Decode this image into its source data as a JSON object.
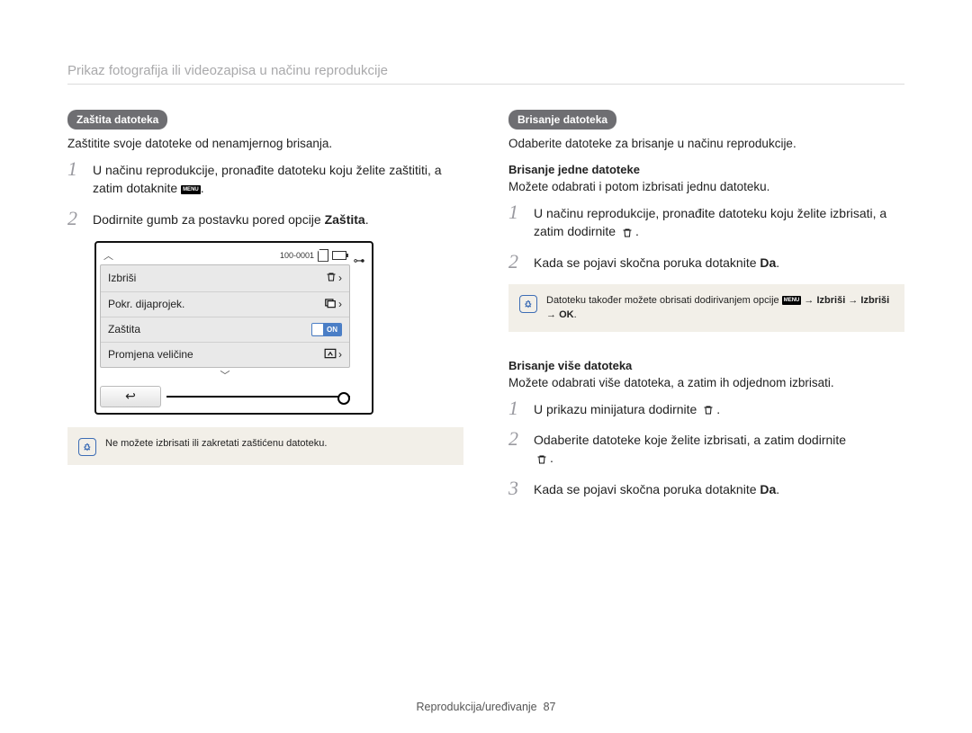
{
  "header": "Prikaz fotografija ili videozapisa u načinu reprodukcije",
  "left": {
    "pill": "Zaštita datoteka",
    "lead": "Zaštitite svoje datoteke od nenamjernog brisanja.",
    "step1_a": "U načinu reprodukcije, pronađite datoteku koju želite zaštititi, a zatim dotaknite ",
    "step1_b": ".",
    "step2_a": "Dodirnite gumb za postavku pored opcije ",
    "step2_bold": "Zaštita",
    "step2_c": ".",
    "camera": {
      "counter": "100-0001",
      "items": {
        "delete": "Izbriši",
        "slideshow": "Pokr. dijaprojek.",
        "protect": "Zaštita",
        "resize": "Promjena veličine"
      },
      "on": "ON",
      "back": "↩"
    },
    "note": "Ne možete izbrisati ili zakretati zaštićenu datoteku."
  },
  "right": {
    "pill": "Brisanje datoteka",
    "lead": "Odaberite datoteke za brisanje u načinu reprodukcije.",
    "sec1": {
      "title": "Brisanje jedne datoteke",
      "lead": "Možete odabrati i potom izbrisati jednu datoteku.",
      "step1_a": "U načinu reprodukcije, pronađite datoteku koju želite izbrisati, a zatim dodirnite ",
      "step1_b": ".",
      "step2_a": "Kada se pojavi skočna poruka dotaknite ",
      "step2_bold": "Da",
      "step2_c": ".",
      "note_a": "Datoteku također možete obrisati dodirivanjem opcije ",
      "note_arrow": " → ",
      "note_b1": "Izbriši",
      "note_b2": "Izbriši",
      "note_ok": "OK",
      "note_c": "."
    },
    "sec2": {
      "title": "Brisanje više datoteka",
      "lead": "Možete odabrati više datoteka, a zatim ih odjednom izbrisati.",
      "step1_a": "U prikazu minijatura dodirnite ",
      "step1_b": ".",
      "step2_a": "Odaberite datoteke koje želite izbrisati, a zatim dodirnite ",
      "step2_b": ".",
      "step3_a": "Kada se pojavi skočna poruka dotaknite ",
      "step3_bold": "Da",
      "step3_c": "."
    }
  },
  "footer_label": "Reprodukcija/uređivanje",
  "page_num": "87",
  "menu_label": "MENU"
}
